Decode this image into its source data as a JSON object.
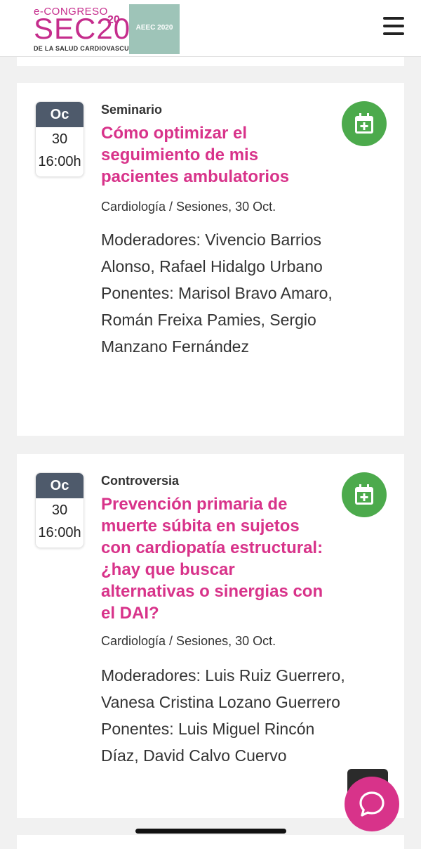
{
  "header": {
    "logo_pre": "e-CONGRESO",
    "logo_main": "SEC20",
    "logo_sup": "20",
    "logo_sub": "DE LA SALUD CARDIOVASCULAR",
    "logo2_text": "AEEC 2020"
  },
  "events": [
    {
      "month": "Oc",
      "day": "30",
      "time": "16:00h",
      "type": "Seminario",
      "title": "Cómo optimizar el seguimiento de mis pacientes ambulatorios",
      "meta": "Cardiología / Sesiones, 30 Oct.",
      "moderators": "Moderadores: Vivencio Barrios Alonso, Rafael Hidalgo Urbano",
      "speakers": "Ponentes: Marisol Bravo Amaro, Román Freixa Pamies, Sergio Manzano Fernández"
    },
    {
      "month": "Oc",
      "day": "30",
      "time": "16:00h",
      "type": "Controversia",
      "title": "Prevención primaria de muerte súbita en sujetos con cardiopatía estructural: ¿hay que buscar alternativas o sinergias con el DAI?",
      "meta": "Cardiología / Sesiones, 30 Oct.",
      "moderators": "Moderadores: Luis Ruiz Guerrero, Vanesa Cristina Lozano Guerrero",
      "speakers": "Ponentes: Luis Miguel Rincón Díaz, David Calvo Cuervo"
    }
  ],
  "icons": {
    "menu": "hamburger-menu-icon",
    "add_calendar": "calendar-plus-icon",
    "chat": "chat-bubble-icon"
  },
  "colors": {
    "accent": "#d8338a",
    "calendar_button": "#4caa4c",
    "date_header": "#4e5a6b",
    "aeec_logo_bg": "#9ec4b8"
  }
}
